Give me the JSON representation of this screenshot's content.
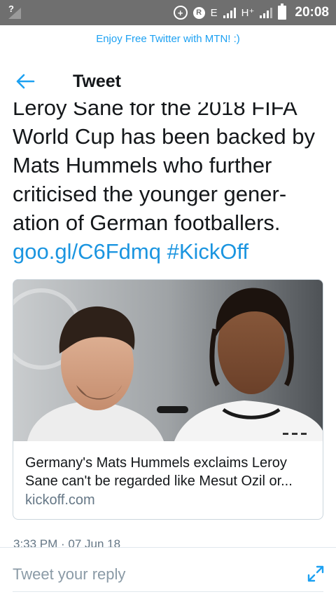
{
  "status_bar": {
    "signal_no_sim": "?",
    "network_e": "E",
    "network_h": "H⁺",
    "time": "20:08",
    "icons": [
      "no-sim-signal-icon",
      "data-saver-icon",
      "registered-icon",
      "signal-icon",
      "battery-icon"
    ]
  },
  "promo": {
    "text": "Enjoy Free Twitter with MTN! :)"
  },
  "header": {
    "title": "Tweet",
    "back_icon": "arrow-left-icon"
  },
  "tweet": {
    "text_before": "Leroy Sane for the 2018 FIFA World Cup has been backed by Mats Hummels who further criticised the younger gener-ation of German footballers. ",
    "link": "goo.gl/C6Fdmq",
    "hashtag": "#KickOff",
    "timestamp": "3:33 PM · 07 Jun 18"
  },
  "card": {
    "title": "Germany's Mats Hummels exclaims Leroy Sane can't be regarded like Mesut Ozil or...",
    "domain": "kickoff.com"
  },
  "reply": {
    "placeholder": "Tweet your reply",
    "expand_icon": "expand-icon"
  },
  "colors": {
    "accent": "#1da1f2",
    "link": "#1b95e0",
    "status_bar": "#6f6f6f",
    "muted": "#657786"
  }
}
